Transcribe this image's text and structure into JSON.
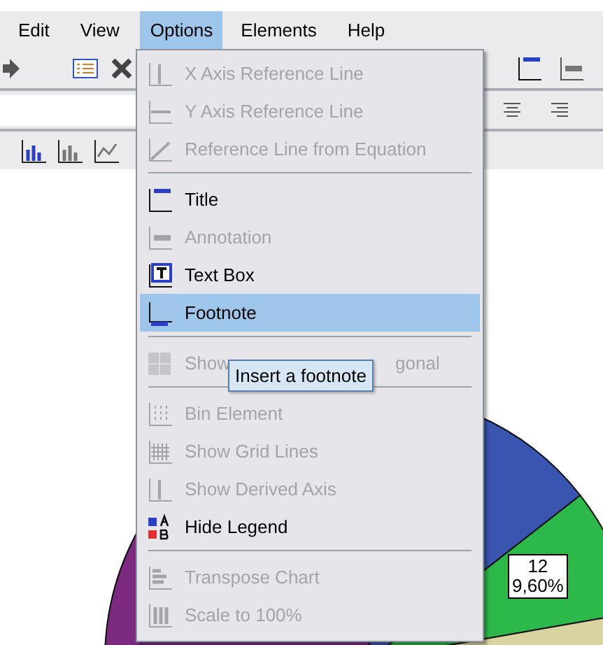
{
  "menubar": [
    {
      "label": "Edit",
      "selected": false
    },
    {
      "label": "View",
      "selected": false
    },
    {
      "label": "Options",
      "selected": true
    },
    {
      "label": "Elements",
      "selected": false
    },
    {
      "label": "Help",
      "selected": false
    }
  ],
  "menu": [
    {
      "kind": "item",
      "label": "X Axis Reference Line",
      "disabled": true,
      "selected": false
    },
    {
      "kind": "item",
      "label": "Y Axis Reference Line",
      "disabled": true,
      "selected": false
    },
    {
      "kind": "item",
      "label": "Reference Line from Equation",
      "disabled": true,
      "selected": false
    },
    {
      "kind": "separator"
    },
    {
      "kind": "item",
      "label": "Title",
      "disabled": false,
      "selected": false
    },
    {
      "kind": "item",
      "label": "Annotation",
      "disabled": true,
      "selected": false
    },
    {
      "kind": "item",
      "label": "Text Box",
      "disabled": false,
      "selected": false
    },
    {
      "kind": "item",
      "label": "Footnote",
      "disabled": false,
      "selected": true
    },
    {
      "kind": "separator"
    },
    {
      "kind": "covered",
      "label_parts": [
        "Show",
        "gonal"
      ],
      "disabled": true,
      "selected": false
    },
    {
      "kind": "separator"
    },
    {
      "kind": "item",
      "label": "Bin Element",
      "disabled": true,
      "selected": false
    },
    {
      "kind": "item",
      "label": "Show Grid Lines",
      "disabled": true,
      "selected": false
    },
    {
      "kind": "item",
      "label": "Show Derived Axis",
      "disabled": true,
      "selected": false
    },
    {
      "kind": "item",
      "label": "Hide Legend",
      "disabled": false,
      "selected": false
    },
    {
      "kind": "separator"
    },
    {
      "kind": "item",
      "label": "Transpose Chart",
      "disabled": true,
      "selected": false
    },
    {
      "kind": "item",
      "label": "Scale to 100%",
      "disabled": true,
      "selected": false
    }
  ],
  "tooltip": "Insert a footnote",
  "pie_label": [
    "12",
    "9,60%"
  ]
}
